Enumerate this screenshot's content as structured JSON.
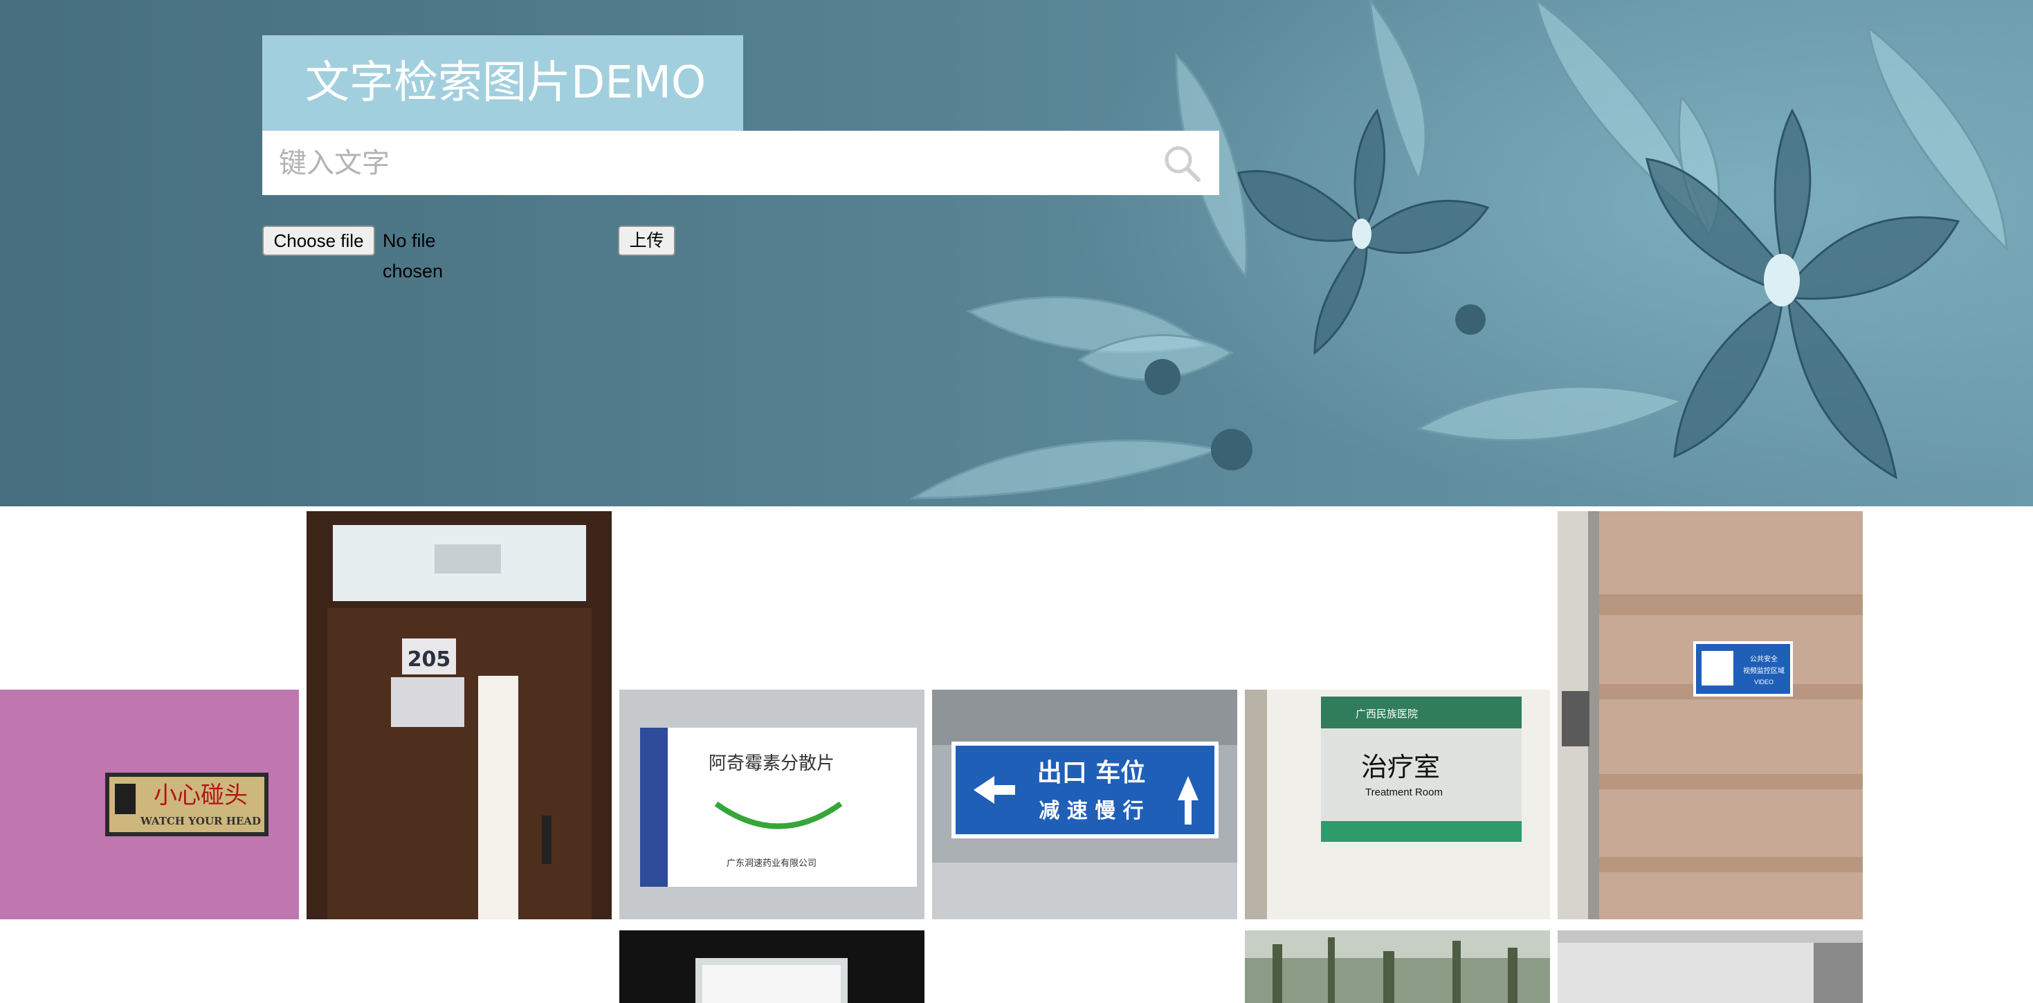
{
  "app": {
    "title": "文字检索图片DEMO"
  },
  "search": {
    "placeholder": "键入文字",
    "value": ""
  },
  "upload": {
    "choose_label": "Choose file",
    "status": "No file chosen",
    "submit_label": "上传"
  },
  "icons": {
    "search": "search-icon"
  },
  "colors": {
    "banner": "#547f8f",
    "title_box": "#a2cfdd",
    "accent_sign_blue": "#1f5fb8"
  },
  "gallery": {
    "items": [
      {
        "sign_text": "小心碰头",
        "sign_sub": "WATCH YOUR HEAD"
      },
      {
        "sign_text": "205"
      },
      {
        "sign_text": "阿奇霉素分散片",
        "sign_sub": "广东洞速药业有限公司"
      },
      {
        "sign_text": "出口 车位",
        "sign_sub": "减 速 慢 行"
      },
      {
        "sign_text": "治疗室",
        "sign_sub": "Treatment Room",
        "sign_header": "广西民族医院"
      },
      {
        "sign_text": "公共安全",
        "sign_sub": "视频监控区域",
        "sign_extra": "VIDEO"
      },
      {},
      {},
      {}
    ]
  }
}
